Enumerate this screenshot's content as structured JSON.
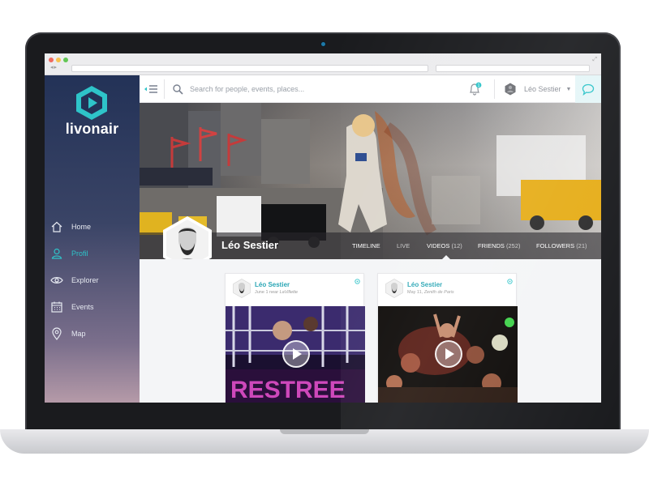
{
  "app": {
    "logo_text": "livonair",
    "brand_color": "#2ec4c9"
  },
  "sidebar": {
    "items": [
      {
        "label": "Home",
        "icon": "home-icon",
        "active": false
      },
      {
        "label": "Profil",
        "icon": "user-icon",
        "active": true
      },
      {
        "label": "Explorer",
        "icon": "eye-icon",
        "active": false
      },
      {
        "label": "Events",
        "icon": "calendar-icon",
        "active": false
      },
      {
        "label": "Map",
        "icon": "map-pin-icon",
        "active": false
      }
    ]
  },
  "topbar": {
    "search_placeholder": "Search for people, events, places...",
    "notification_count": "1",
    "user_name": "Léo Sestier"
  },
  "profile": {
    "name": "Léo Sestier",
    "tabs": [
      {
        "label": "TIMELINE",
        "count": "",
        "active": false
      },
      {
        "label": "LIVE",
        "count": "",
        "active": false
      },
      {
        "label": "VIDEOS",
        "count": "(12)",
        "active": true
      },
      {
        "label": "FRIENDS",
        "count": "(252)",
        "active": false
      },
      {
        "label": "FOLLOWERS",
        "count": "(21)",
        "active": false
      }
    ]
  },
  "videos": [
    {
      "user": "Léo Sestier",
      "date": "June 1 near",
      "place": "LaVillette"
    },
    {
      "user": "Léo Sestier",
      "date": "May 11,",
      "place": "Zenith de Paris"
    }
  ]
}
